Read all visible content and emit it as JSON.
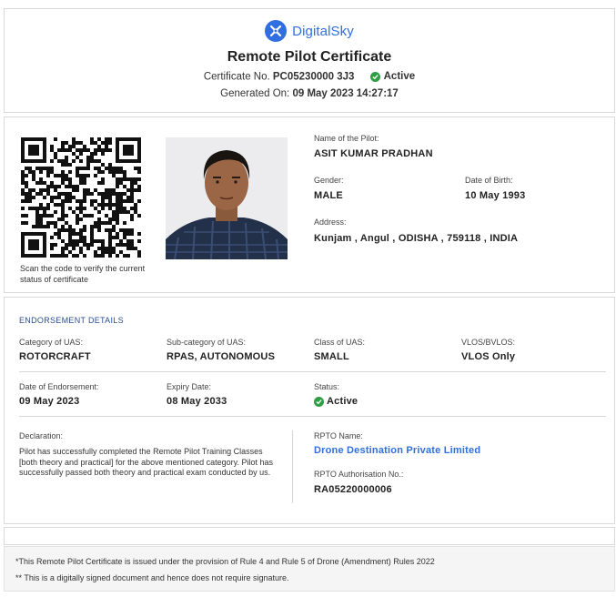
{
  "header": {
    "brand": "DigitalSky",
    "title": "Remote Pilot Certificate",
    "cert_no_label": "Certificate No.",
    "cert_no": "PC05230000 3J3",
    "status": "Active",
    "generated_label": "Generated On:",
    "generated_value": "09 May 2023 14:27:17"
  },
  "pilot": {
    "qr_caption": "Scan the code to verify the current status of certificate",
    "name_label": "Name of the Pilot:",
    "name": "ASIT KUMAR PRADHAN",
    "gender_label": "Gender:",
    "gender": "MALE",
    "dob_label": "Date of Birth:",
    "dob": "10 May 1993",
    "address_label": "Address:",
    "address": "Kunjam , Angul , ODISHA , 759118 , INDIA"
  },
  "endorsement": {
    "title": "ENDORSEMENT DETAILS",
    "category_label": "Category of UAS:",
    "category": "ROTORCRAFT",
    "subcategory_label": "Sub-category of UAS:",
    "subcategory": "RPAS, AUTONOMOUS",
    "class_label": "Class of UAS:",
    "class": "SMALL",
    "vlos_label": "VLOS/BVLOS:",
    "vlos": "VLOS Only",
    "date_label": "Date of Endorsement:",
    "date": "09 May 2023",
    "expiry_label": "Expiry Date:",
    "expiry": "08 May 2033",
    "status_label": "Status:",
    "status": "Active",
    "declaration_label": "Declaration:",
    "declaration": "Pilot has successfully completed the Remote Pilot Training Classes [both theory and practical] for the above mentioned category. Pilot has successfully passed both theory and practical exam conducted by us.",
    "rpto_name_label": "RPTO Name:",
    "rpto_name": "Drone Destination Private Limited",
    "rpto_auth_label": "RPTO Authorisation No.:",
    "rpto_auth": "RA05220000006"
  },
  "footer": {
    "note1": "*This Remote Pilot Certificate is issued under the provision of Rule 4 and Rule 5 of Drone (Amendment) Rules 2022",
    "note2": "** This is a digitally signed document and hence does not require signature."
  },
  "colors": {
    "brand": "#2f6fe0",
    "active": "#2e9e44",
    "section_title": "#2a4f8f"
  }
}
